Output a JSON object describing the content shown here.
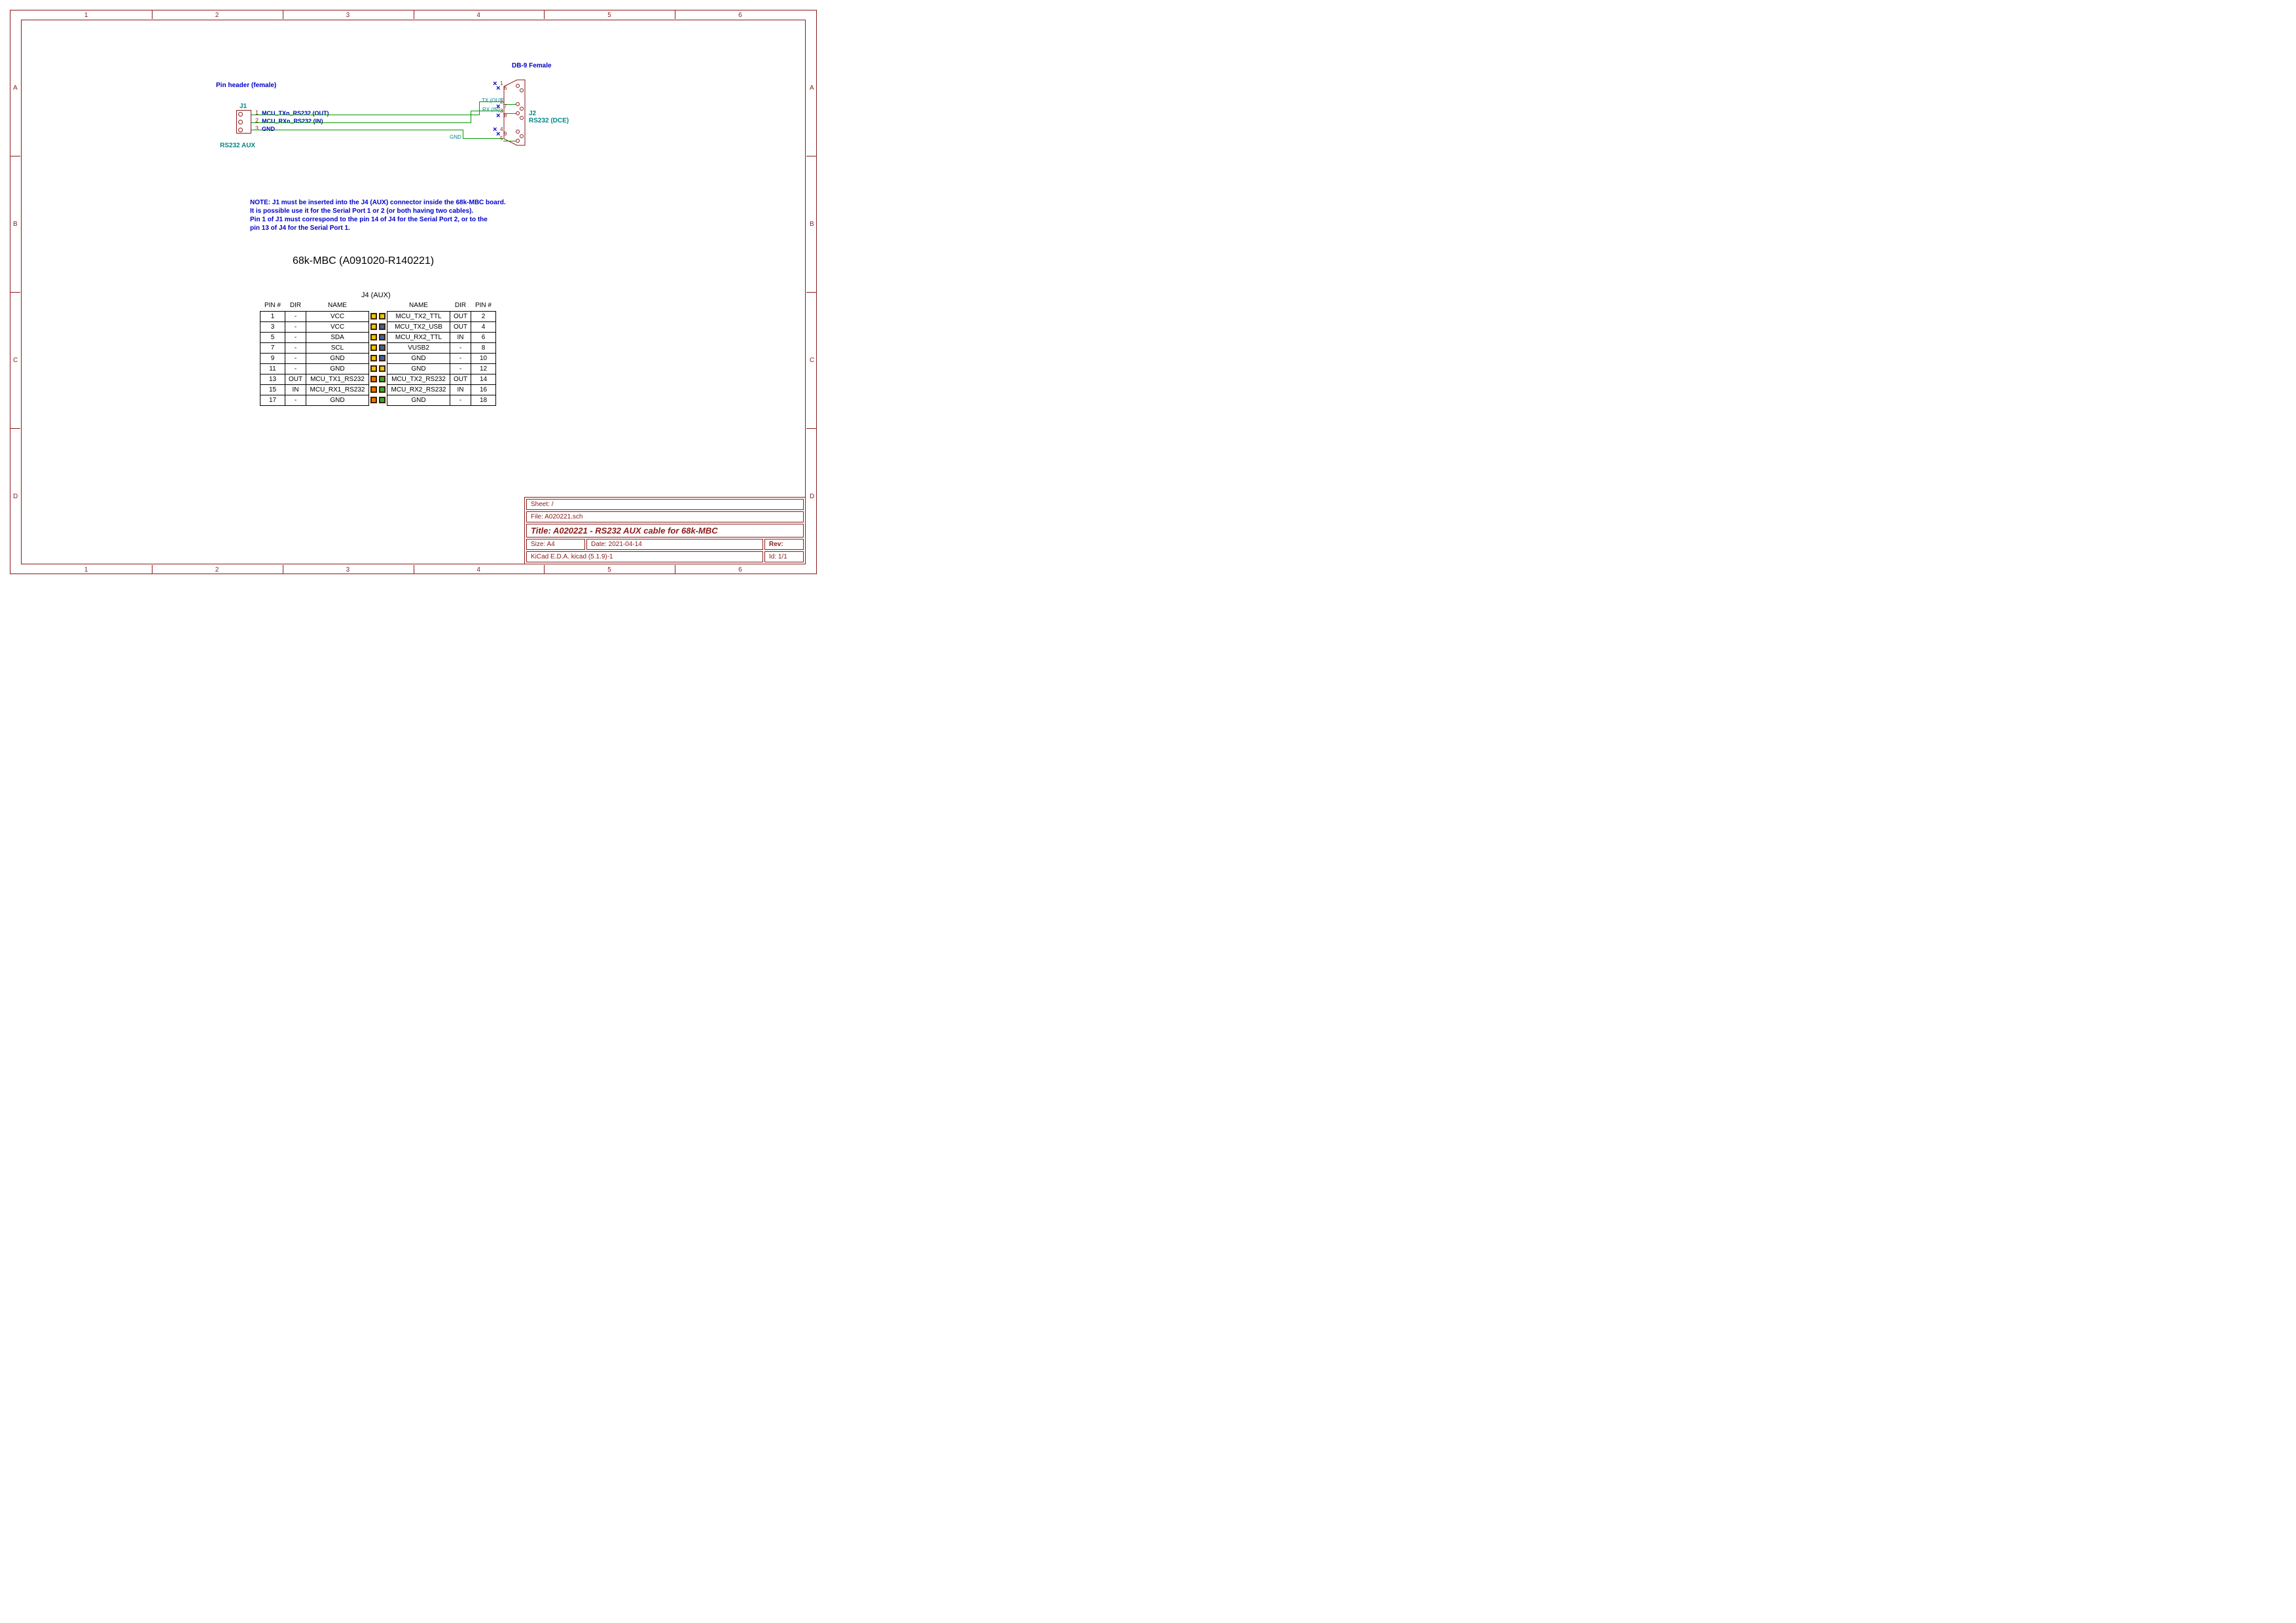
{
  "ruler": {
    "top": [
      "1",
      "2",
      "3",
      "4",
      "5",
      "6"
    ],
    "side": [
      "A",
      "B",
      "C",
      "D"
    ]
  },
  "labels": {
    "db9": "DB-9 Female",
    "pin_header": "Pin header (female)",
    "j1": "J1",
    "rs232_aux": "RS232 AUX",
    "j2": "J2",
    "rs232_dce": "RS232 (DCE)",
    "tx_out": "TX (OUT)",
    "rx_in": "RX (IN)",
    "gnd": "GND",
    "nets": [
      "MCU_TXn_RS232 (OUT)",
      "MCU_RXn_RS232 (IN)",
      "GND"
    ],
    "j1_pins": [
      "1",
      "2",
      "3"
    ],
    "db9_pins": [
      "1",
      "6",
      "2",
      "7",
      "3",
      "8",
      "4",
      "9",
      "5"
    ]
  },
  "note": "NOTE: J1 must be inserted into the J4 (AUX) connector inside the 68k-MBC board.\nIt is possible use it for the Serial Port 1 or 2 (or both having two cables).\nPin 1 of J1 must correspond to the pin 14 of J4 for the Serial Port 2, or to the\npin 13 of J4 for the Serial Port 1.",
  "board": "68k-MBC (A091020-R140221)",
  "table_title": "J4 (AUX)",
  "table_hdr_l": [
    "PIN #",
    "DIR",
    "NAME"
  ],
  "table_hdr_r": [
    "NAME",
    "DIR",
    "PIN #"
  ],
  "table_rows": [
    {
      "lp": "1",
      "ld": "-",
      "ln": "VCC",
      "lc": "#e8c800",
      "rc": "#e8c800",
      "rn": "MCU_TX2_TTL",
      "rd": "OUT",
      "rp": "2"
    },
    {
      "lp": "3",
      "ld": "-",
      "ln": "VCC",
      "lc": "#e8c800",
      "rc": "#4060a0",
      "rn": "MCU_TX2_USB",
      "rd": "OUT",
      "rp": "4"
    },
    {
      "lp": "5",
      "ld": "-",
      "ln": "SDA",
      "lc": "#e8c800",
      "rc": "#4060a0",
      "rn": "MCU_RX2_TTL",
      "rd": "IN",
      "rp": "6"
    },
    {
      "lp": "7",
      "ld": "-",
      "ln": "SCL",
      "lc": "#e8c800",
      "rc": "#4060a0",
      "rn": "VUSB2",
      "rd": "-",
      "rp": "8"
    },
    {
      "lp": "9",
      "ld": "-",
      "ln": "GND",
      "lc": "#e8c800",
      "rc": "#4060a0",
      "rn": "GND",
      "rd": "-",
      "rp": "10"
    },
    {
      "lp": "11",
      "ld": "-",
      "ln": "GND",
      "lc": "#e8c800",
      "rc": "#e8c800",
      "rn": "GND",
      "rd": "-",
      "rp": "12"
    },
    {
      "lp": "13",
      "ld": "OUT",
      "ln": "MCU_TX1_RS232",
      "lc": "#e87800",
      "rc": "#38a838",
      "rn": "MCU_TX2_RS232",
      "rd": "OUT",
      "rp": "14"
    },
    {
      "lp": "15",
      "ld": "IN",
      "ln": "MCU_RX1_RS232",
      "lc": "#e87800",
      "rc": "#38a838",
      "rn": "MCU_RX2_RS232",
      "rd": "IN",
      "rp": "16"
    },
    {
      "lp": "17",
      "ld": "-",
      "ln": "GND",
      "lc": "#e87800",
      "rc": "#38a838",
      "rn": "GND",
      "rd": "-",
      "rp": "18"
    }
  ],
  "titleblock": {
    "sheet": "Sheet: /",
    "file": "File: A020221.sch",
    "title_prefix": "Title: ",
    "title": "A020221 - RS232 AUX cable for 68k-MBC",
    "size": "Size: A4",
    "date": "Date: 2021-04-14",
    "rev": "Rev:",
    "kicad": "KiCad E.D.A.  kicad (5.1.9)-1",
    "id": "Id: 1/1"
  }
}
